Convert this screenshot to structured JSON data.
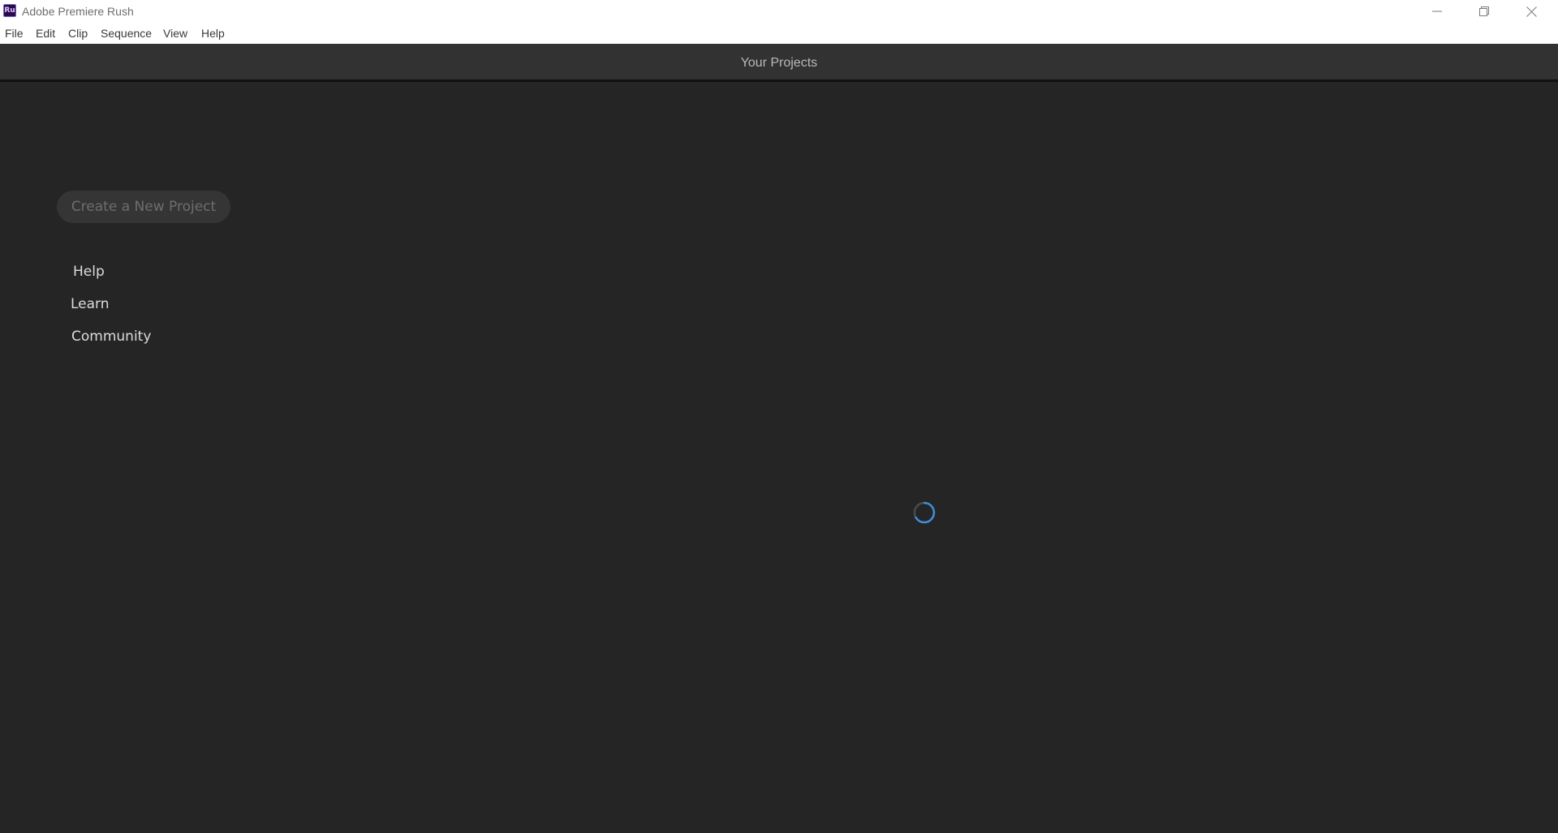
{
  "window": {
    "logo_text": "Ru",
    "title": "Adobe Premiere Rush"
  },
  "menu": {
    "items": [
      "File",
      "Edit",
      "Clip",
      "Sequence",
      "View",
      "Help"
    ]
  },
  "header": {
    "title": "Your Projects"
  },
  "sidebar": {
    "new_project_label": "Create a New Project",
    "links": [
      "Help",
      "Learn",
      "Community"
    ]
  },
  "loading": {
    "icon": "loading-spinner-icon",
    "accent_color": "#3d8fe0"
  },
  "colors": {
    "background": "#252525",
    "header": "#323232"
  }
}
